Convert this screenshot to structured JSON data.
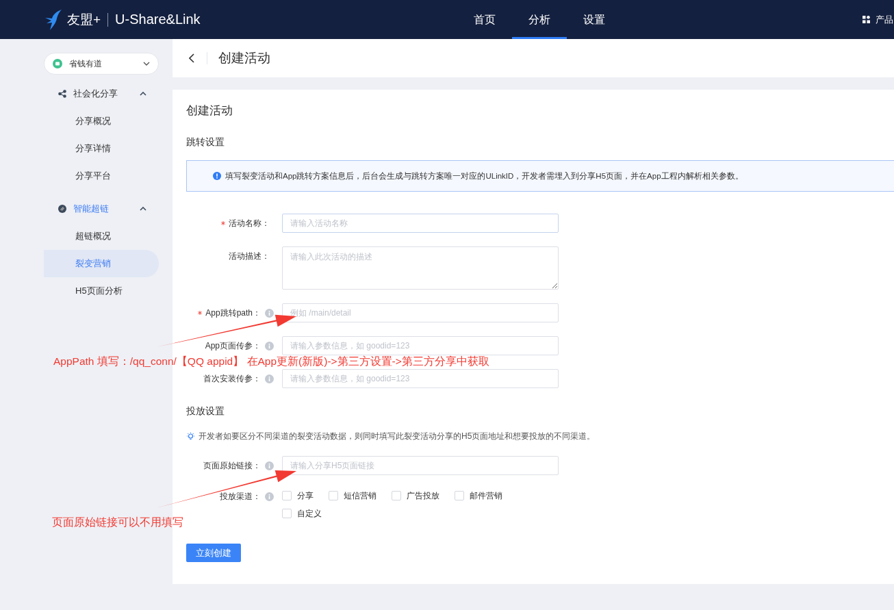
{
  "topbar": {
    "brand": "友盟+",
    "product": "U-Share&Link",
    "nav": [
      {
        "label": "首页",
        "selected": false
      },
      {
        "label": "分析",
        "selected": true
      },
      {
        "label": "设置",
        "selected": false
      }
    ],
    "right_menu": "产品"
  },
  "sidebar": {
    "app_selector": "省钱有道",
    "groups": [
      {
        "label": "社会化分享",
        "selected": false,
        "expanded": true,
        "items": [
          {
            "label": "分享概况",
            "selected": false
          },
          {
            "label": "分享详情",
            "selected": false
          },
          {
            "label": "分享平台",
            "selected": false
          }
        ]
      },
      {
        "label": "智能超链",
        "selected": true,
        "expanded": true,
        "items": [
          {
            "label": "超链概况",
            "selected": false
          },
          {
            "label": "裂变营销",
            "selected": true
          },
          {
            "label": "H5页面分析",
            "selected": false
          }
        ]
      }
    ]
  },
  "page_header": {
    "title": "创建活动"
  },
  "form": {
    "title": "创建活动",
    "section_1": "跳转设置",
    "notice": "填写裂变活动和App跳转方案信息后，后台会生成与跳转方案唯一对应的ULinkID，开发者需埋入到分享H5页面，并在App工程内解析相关参数。",
    "fields": [
      {
        "label": "活动名称：",
        "required": true,
        "info": false,
        "kind": "input",
        "placeholder": "请输入活动名称"
      },
      {
        "label": "活动描述：",
        "required": false,
        "info": false,
        "kind": "textarea",
        "placeholder": "请输入此次活动的描述"
      },
      {
        "label": "App跳转path：",
        "required": true,
        "info": true,
        "kind": "input",
        "placeholder": "例如 /main/detail"
      },
      {
        "label": "App页面传参：",
        "required": false,
        "info": true,
        "kind": "input",
        "placeholder": "请输入参数信息，如 goodid=123"
      },
      {
        "label": "首次安装传参：",
        "required": false,
        "info": true,
        "kind": "input",
        "placeholder": "请输入参数信息，如 goodid=123"
      }
    ],
    "section_2": "投放设置",
    "tip": "开发者如要区分不同渠道的裂变活动数据，则同时填写此裂变活动分享的H5页面地址和想要投放的不同渠道。",
    "link_field": {
      "label": "页面原始链接：",
      "info": true,
      "placeholder": "请输入分享H5页面链接"
    },
    "channels": {
      "label": "投放渠道：",
      "info": true,
      "options": [
        {
          "label": "分享",
          "checked": false
        },
        {
          "label": "短信营销",
          "checked": false
        },
        {
          "label": "广告投放",
          "checked": false
        },
        {
          "label": "邮件营销",
          "checked": false
        },
        {
          "label": "自定义",
          "checked": false
        }
      ]
    },
    "submit": "立刻创建"
  },
  "annotations": [
    {
      "text": "AppPath 填写：/qq_conn/【QQ appid】 在App更新(新版)->第三方设置->第三方分享中获取"
    },
    {
      "text": "页面原始链接可以不用填写"
    }
  ]
}
